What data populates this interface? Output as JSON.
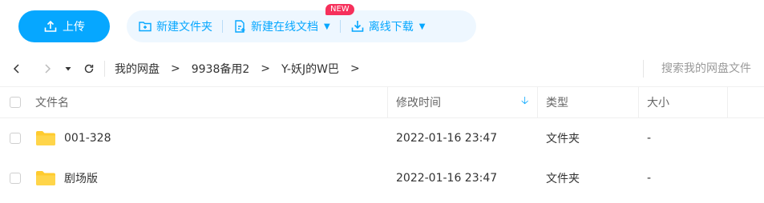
{
  "toolbar": {
    "upload_label": "上传",
    "new_folder_label": "新建文件夹",
    "new_doc_label": "新建在线文档",
    "new_badge": "NEW",
    "offline_download_label": "离线下载",
    "accent_color": "#06a7ff"
  },
  "navbar": {
    "breadcrumb": [
      "我的网盘",
      "9938备用2",
      "Y-妖J的W巴"
    ],
    "separator": ">",
    "search_placeholder": "搜索我的网盘文件"
  },
  "table": {
    "headers": {
      "name": "文件名",
      "modified": "修改时间",
      "type": "类型",
      "size": "大小"
    },
    "sort_icon": "sort-down-icon",
    "rows": [
      {
        "name": "001-328",
        "modified": "2022-01-16 23:47",
        "type": "文件夹",
        "size": "-"
      },
      {
        "name": "剧场版",
        "modified": "2022-01-16 23:47",
        "type": "文件夹",
        "size": "-"
      }
    ]
  }
}
